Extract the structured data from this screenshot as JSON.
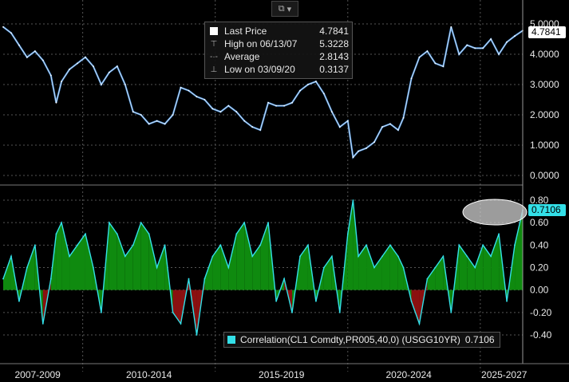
{
  "toolbar": {
    "chart_type_icon": "line-chart-icon",
    "dropdown_icon": "chevron-down-icon"
  },
  "legend": {
    "last_price_label": "Last Price",
    "last_price_value": "4.7841",
    "high_label": "High on 06/13/07",
    "high_value": "5.3228",
    "average_label": "Average",
    "average_value": "2.8143",
    "low_label": "Low on 03/09/20",
    "low_value": "0.3137"
  },
  "lower_legend": {
    "label": "Correlation(CL1 Comdty,PR005,40,0) (USGG10YR)",
    "value": "0.7106"
  },
  "colors": {
    "price_line": "#4a90d9",
    "price_highlight": "#ffffff",
    "corr_line": "#33e0e8",
    "corr_fill_pos": "#0f8a0f",
    "corr_fill_neg": "#8a1010",
    "background": "#000000"
  },
  "chart_data": [
    {
      "type": "line",
      "name": "Last Price",
      "yticks": [
        "5.0000",
        "4.0000",
        "3.0000",
        "2.0000",
        "1.0000",
        "0.0000"
      ],
      "ylim": [
        0,
        5
      ],
      "last_value_label": "4.7841",
      "x": [
        2007.0,
        2007.3,
        2007.6,
        2007.9,
        2008.2,
        2008.5,
        2008.8,
        2009.0,
        2009.2,
        2009.5,
        2009.8,
        2010.1,
        2010.4,
        2010.7,
        2011.0,
        2011.3,
        2011.6,
        2011.9,
        2012.2,
        2012.5,
        2012.8,
        2013.1,
        2013.4,
        2013.7,
        2014.0,
        2014.3,
        2014.6,
        2014.9,
        2015.2,
        2015.5,
        2015.8,
        2016.1,
        2016.4,
        2016.7,
        2017.0,
        2017.3,
        2017.6,
        2017.9,
        2018.2,
        2018.5,
        2018.8,
        2019.1,
        2019.4,
        2019.7,
        2020.0,
        2020.2,
        2020.4,
        2020.7,
        2021.0,
        2021.3,
        2021.6,
        2021.9,
        2022.1,
        2022.4,
        2022.7,
        2023.0,
        2023.3,
        2023.6,
        2023.9,
        2024.2,
        2024.5,
        2024.8,
        2025.1,
        2025.4,
        2025.7,
        2026.0,
        2026.3,
        2026.6
      ],
      "y": [
        4.9,
        4.7,
        4.3,
        3.9,
        4.1,
        3.8,
        3.3,
        2.4,
        3.1,
        3.5,
        3.7,
        3.9,
        3.6,
        3.0,
        3.4,
        3.6,
        3.0,
        2.1,
        2.0,
        1.7,
        1.8,
        1.7,
        2.0,
        2.9,
        2.8,
        2.6,
        2.5,
        2.2,
        2.1,
        2.3,
        2.1,
        1.8,
        1.6,
        1.5,
        2.4,
        2.3,
        2.3,
        2.4,
        2.8,
        3.0,
        3.1,
        2.7,
        2.1,
        1.6,
        1.8,
        0.6,
        0.8,
        0.9,
        1.1,
        1.6,
        1.7,
        1.5,
        1.9,
        3.2,
        3.9,
        4.1,
        3.7,
        3.6,
        4.9,
        4.0,
        4.3,
        4.2,
        4.2,
        4.5,
        4.0,
        4.4,
        4.6,
        4.78
      ]
    },
    {
      "type": "area",
      "name": "Correlation(CL1 Comdty,PR005,40,0) (USGG10YR)",
      "yticks": [
        "0.80",
        "0.60",
        "0.40",
        "0.20",
        "0.00",
        "-0.20",
        "-0.40"
      ],
      "ylim": [
        -0.46,
        0.82
      ],
      "last_value_label": "0.7106",
      "x": [
        2007.0,
        2007.3,
        2007.6,
        2007.9,
        2008.2,
        2008.5,
        2008.8,
        2009.0,
        2009.2,
        2009.5,
        2009.8,
        2010.1,
        2010.4,
        2010.7,
        2011.0,
        2011.3,
        2011.6,
        2011.9,
        2012.2,
        2012.5,
        2012.8,
        2013.1,
        2013.4,
        2013.7,
        2014.0,
        2014.3,
        2014.6,
        2014.9,
        2015.2,
        2015.5,
        2015.8,
        2016.1,
        2016.4,
        2016.7,
        2017.0,
        2017.3,
        2017.6,
        2017.9,
        2018.2,
        2018.5,
        2018.8,
        2019.1,
        2019.4,
        2019.7,
        2020.0,
        2020.2,
        2020.4,
        2020.7,
        2021.0,
        2021.3,
        2021.6,
        2021.9,
        2022.1,
        2022.4,
        2022.7,
        2023.0,
        2023.3,
        2023.6,
        2023.9,
        2024.2,
        2024.5,
        2024.8,
        2025.1,
        2025.4,
        2025.7,
        2026.0,
        2026.3,
        2026.6
      ],
      "y": [
        0.1,
        0.3,
        -0.1,
        0.2,
        0.4,
        -0.3,
        0.1,
        0.5,
        0.6,
        0.3,
        0.4,
        0.5,
        0.2,
        -0.2,
        0.6,
        0.5,
        0.3,
        0.4,
        0.6,
        0.5,
        0.2,
        0.4,
        -0.2,
        -0.3,
        0.1,
        -0.4,
        0.1,
        0.3,
        0.4,
        0.2,
        0.5,
        0.6,
        0.3,
        0.4,
        0.6,
        -0.1,
        0.1,
        -0.2,
        0.3,
        0.4,
        -0.1,
        0.2,
        0.3,
        -0.2,
        0.5,
        0.8,
        0.3,
        0.4,
        0.2,
        0.3,
        0.4,
        0.3,
        0.2,
        -0.1,
        -0.3,
        0.1,
        0.2,
        0.3,
        -0.2,
        0.4,
        0.3,
        0.2,
        0.4,
        0.3,
        0.5,
        -0.1,
        0.4,
        0.7106
      ]
    }
  ],
  "x_axis": {
    "labels": [
      "2007-2009",
      "2010-2014",
      "2015-2019",
      "2020-2024",
      "2025-2027"
    ]
  }
}
